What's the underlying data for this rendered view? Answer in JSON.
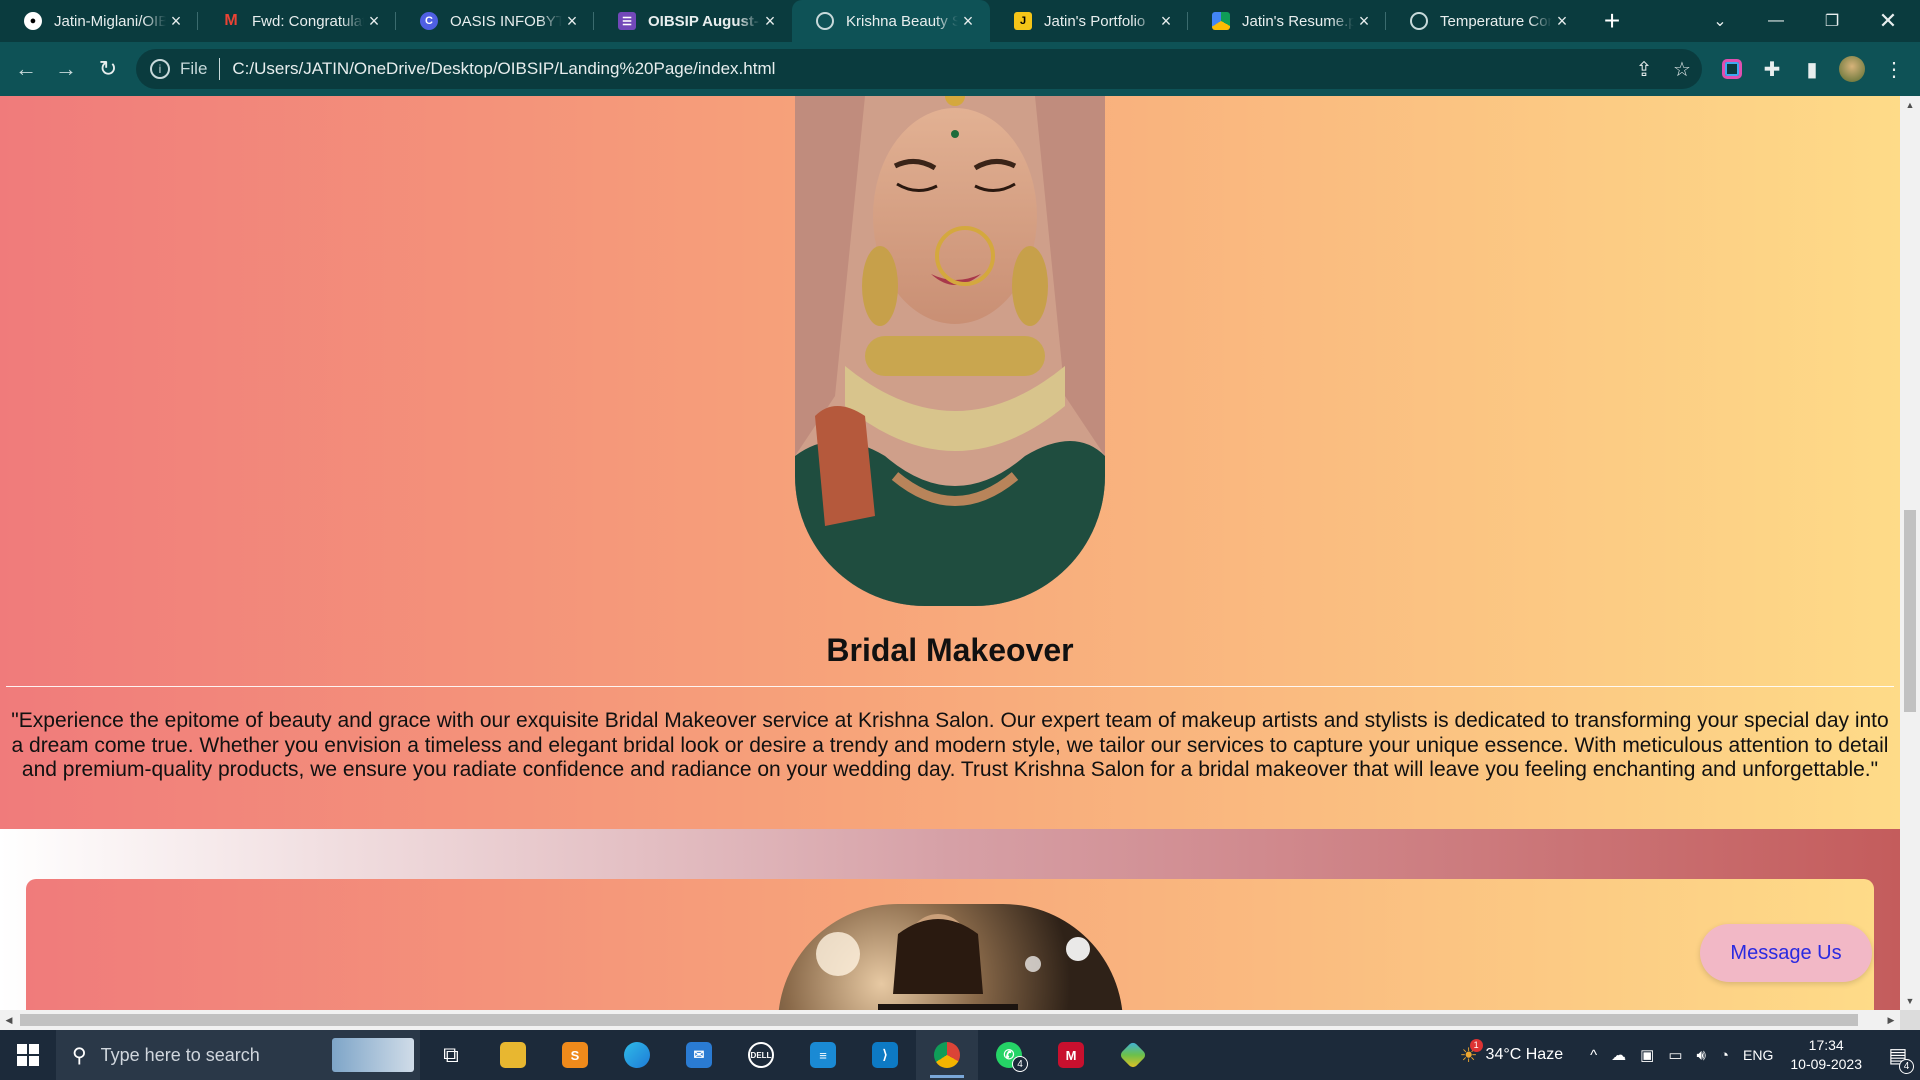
{
  "browser": {
    "tabs": [
      {
        "title": "Jatin-Miglani/OIB",
        "icon": "github-icon",
        "active": false
      },
      {
        "title": "Fwd: Congratulati",
        "icon": "gmail-icon",
        "active": false
      },
      {
        "title": "OASIS INFOBYTE",
        "icon": "canva-icon",
        "active": false
      },
      {
        "title": "OIBSIP August- P",
        "icon": "forms-icon",
        "active": false
      },
      {
        "title": "Krishna Beauty Sa",
        "icon": "globe-icon",
        "active": true
      },
      {
        "title": "Jatin's Portfolio",
        "icon": "portfolio-icon",
        "active": false
      },
      {
        "title": "Jatin's Resume.pd",
        "icon": "drive-icon",
        "active": false
      },
      {
        "title": "Temperature Con",
        "icon": "globe-icon",
        "active": false
      }
    ],
    "address": {
      "scheme": "File",
      "url": "C:/Users/JATIN/OneDrive/Desktop/OIBSIP/Landing%20Page/index.html"
    }
  },
  "page": {
    "section_title": "Bridal Makeover",
    "section_description": "\"Experience the epitome of beauty and grace with our exquisite Bridal Makeover service at Krishna Salon. Our expert team of makeup artists and stylists is dedicated to transforming your special day into a dream come true. Whether you envision a timeless and elegant bridal look or desire a trendy and modern style, we tailor our services to capture your unique essence. With meticulous attention to detail and premium-quality products, we ensure you radiate confidence and radiance on your wedding day. Trust Krishna Salon for a bridal makeover that will leave you feeling enchanting and unforgettable.\"",
    "message_button": "Message Us"
  },
  "taskbar": {
    "search_placeholder": "Type here to search",
    "weather": "34°C  Haze",
    "language": "ENG",
    "time": "17:34",
    "date": "10-09-2023",
    "whatsapp_badge": "4",
    "notification_count": "4",
    "weather_badge": "1"
  }
}
